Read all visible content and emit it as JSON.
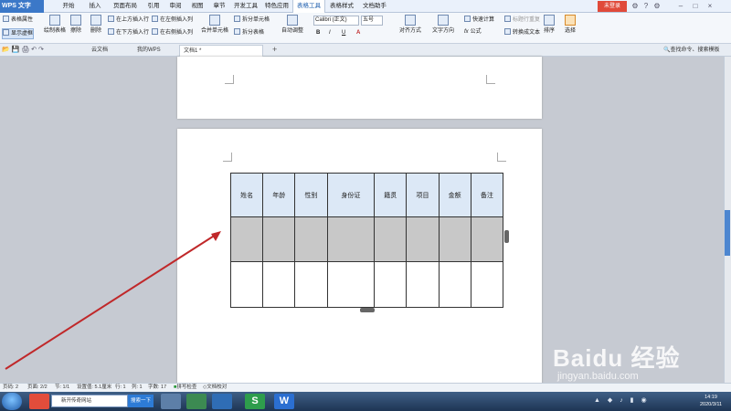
{
  "app": {
    "name": "WPS 文字",
    "login_label": "未登录"
  },
  "menu": {
    "items": [
      {
        "label": "开始"
      },
      {
        "label": "插入"
      },
      {
        "label": "页面布局"
      },
      {
        "label": "引用"
      },
      {
        "label": "审阅"
      },
      {
        "label": "视图"
      },
      {
        "label": "章节"
      },
      {
        "label": "开发工具"
      },
      {
        "label": "特色应用"
      },
      {
        "label": "表格工具"
      },
      {
        "label": "表格样式"
      },
      {
        "label": "文档助手"
      }
    ],
    "active_index": 9
  },
  "ribbon": {
    "table_props": "表格属性",
    "show_gridlines": "显示虚框",
    "draw_table": "绘制表格",
    "erase": "擦除",
    "delete": "删除",
    "insert_above": "在上方插入行",
    "insert_below": "在下方插入行",
    "insert_left": "在左侧插入列",
    "insert_right": "在右侧插入列",
    "merge_cells": "合并单元格",
    "split_cells": "拆分单元格",
    "split_table": "拆分表格",
    "autofit": "自动调整",
    "font_name": "Calibri (正文)",
    "font_size": "五号",
    "bold": "B",
    "italic": "I",
    "underline": "U",
    "font_color": "A",
    "align": "对齐方式",
    "text_direction": "文字方向",
    "quick_calc": "快速计算",
    "formula": "公式",
    "repeat_header": "标题行重复",
    "convert_text": "转换成文本",
    "sort": "排序",
    "select": "选择"
  },
  "tabs": {
    "items": [
      {
        "label": "云文档"
      },
      {
        "label": "我的WPS"
      },
      {
        "label": "文档1 *"
      }
    ],
    "search_placeholder": "查找命令、搜索模板"
  },
  "table": {
    "headers": [
      "姓名",
      "年龄",
      "性别",
      "身份证",
      "籍贯",
      "项目",
      "金额",
      "备注"
    ],
    "rows": [
      [
        "",
        "",
        "",
        "",
        "",
        "",
        "",
        ""
      ],
      [
        "",
        "",
        "",
        "",
        "",
        "",
        "",
        ""
      ]
    ]
  },
  "status": {
    "page": "页码: 2",
    "pages": "页面: 2/2",
    "section": "节: 1/1",
    "setting": "设置值: 5.1厘米",
    "row": "行: 1",
    "col": "列: 1",
    "words": "字数: 17",
    "spell": "拼写检查",
    "proof": "文档校对"
  },
  "taskbar": {
    "search_text": "新开传奇网站",
    "search_button": "搜索一下",
    "time": "14:19",
    "date": "2020/3/11"
  },
  "watermark": {
    "brand": "Baidu 经验",
    "url": "jingyan.baidu.com"
  },
  "colors": {
    "accent": "#3b78c8",
    "header_fill": "#dce8f6",
    "selected_row_fill": "#c8c8c8",
    "arrow": "#c0282a"
  }
}
